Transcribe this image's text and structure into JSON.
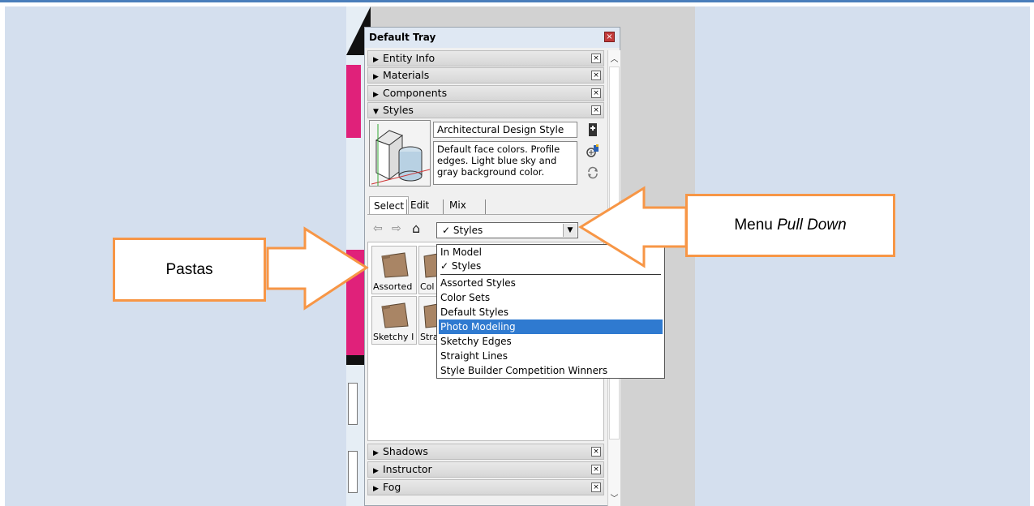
{
  "tray": {
    "title": "Default Tray",
    "close_glyph": "×",
    "sections_top": [
      {
        "label": "Entity Info",
        "arrow": "▶"
      },
      {
        "label": "Materials",
        "arrow": "▶"
      },
      {
        "label": "Components",
        "arrow": "▶"
      },
      {
        "label": "Styles",
        "arrow": "▼"
      }
    ],
    "sections_bottom": [
      {
        "label": "Shadows",
        "arrow": "▶"
      },
      {
        "label": "Instructor",
        "arrow": "▶"
      },
      {
        "label": "Fog",
        "arrow": "▶"
      }
    ],
    "section_close_glyph": "×"
  },
  "styles": {
    "name": "Architectural Design Style",
    "description": "Default face colors. Profile edges. Light blue sky and gray background color.",
    "tabs": {
      "select": "Select",
      "edit": "Edit",
      "mix": "Mix"
    },
    "combo_value": "✓ Styles",
    "folders": [
      "Assorted",
      "Col",
      "Sketchy I",
      "Stra"
    ]
  },
  "dropdown": {
    "items": [
      {
        "label": "In Model"
      },
      {
        "label": "✓ Styles"
      },
      {
        "label": "Assorted Styles"
      },
      {
        "label": "Color Sets"
      },
      {
        "label": "Default Styles"
      },
      {
        "label": "Photo Modeling",
        "selected": true
      },
      {
        "label": "Sketchy Edges"
      },
      {
        "label": "Straight Lines"
      },
      {
        "label": "Style Builder Competition Winners"
      }
    ]
  },
  "callouts": {
    "pastas": "Pastas",
    "menu_prefix": "Menu ",
    "menu_emph": "Pull Down"
  },
  "colors": {
    "callout_border": "#f79646",
    "slide_bg": "#d4dfee",
    "selection": "#2f7ad0"
  }
}
